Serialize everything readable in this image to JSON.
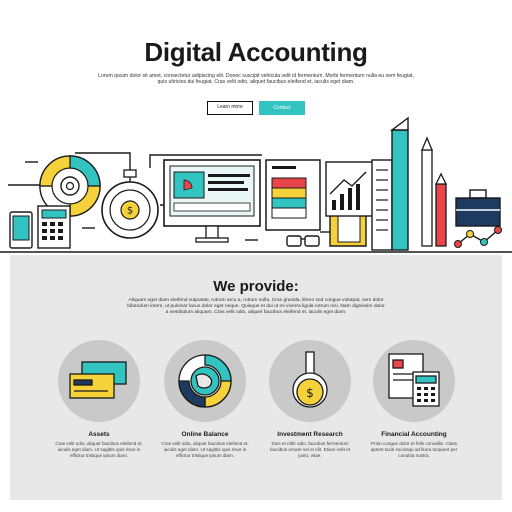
{
  "hero": {
    "title": "Digital Accounting",
    "intro": "Lorem ipsum dolor sit amet, consectetur adipiscing elit. Donec suscipit vehicula velit id fermentum. Morbi fermentum nulla eu sem feugiat, quis ultricies dui feugiat. Cras velit odio, aliquet faucibus eleifend et, iaculis eget diam.",
    "learn_more": "Learn more",
    "contact": "Contact"
  },
  "provide": {
    "title": "We provide:",
    "text": "Aliquam eget diam eleifend vulputate, rutrum arcu a, rutrum nulla. Cras gravida, libero sed congue volutpat, sem dolor bibendum lorem, ut pulvinar lacus dolor eget neque. Quisque et dui ut mi viverra ligula rutrum nisi. Nam dignissim dolor a vestibulum aliquam. Cras velit odio, aliquet faucibus eleifend et, iaculis eget diam."
  },
  "features": [
    {
      "name": "Assets",
      "desc": "Cras velit odio, aliquet faucibus eleifend et, iaculis eget diam. Ut sagittis quis risus in efficitur tristique ipsum diam."
    },
    {
      "name": "Online Balance",
      "desc": "Cras velit odio, aliquet faucibus eleifend et, iaculis eget diam. Ut sagittis quis risus in efficitur tristique ipsum diam."
    },
    {
      "name": "Investment Research",
      "desc": "Duis et nibh odio, faucibus fermentum faucibus ornare vel et elit. Etiam velit et justo, vitae."
    },
    {
      "name": "Financial Accounting",
      "desc": "Proin congue dolor et felis convallis. Class aptent taciti sociosqu ad litora torquent per conubia nostra."
    }
  ],
  "colors": {
    "accent_teal": "#33c3c0",
    "accent_yellow": "#f6d23a",
    "accent_red": "#e8464b",
    "accent_blue": "#2f6fb5",
    "band_gray": "#e8e8e8"
  }
}
